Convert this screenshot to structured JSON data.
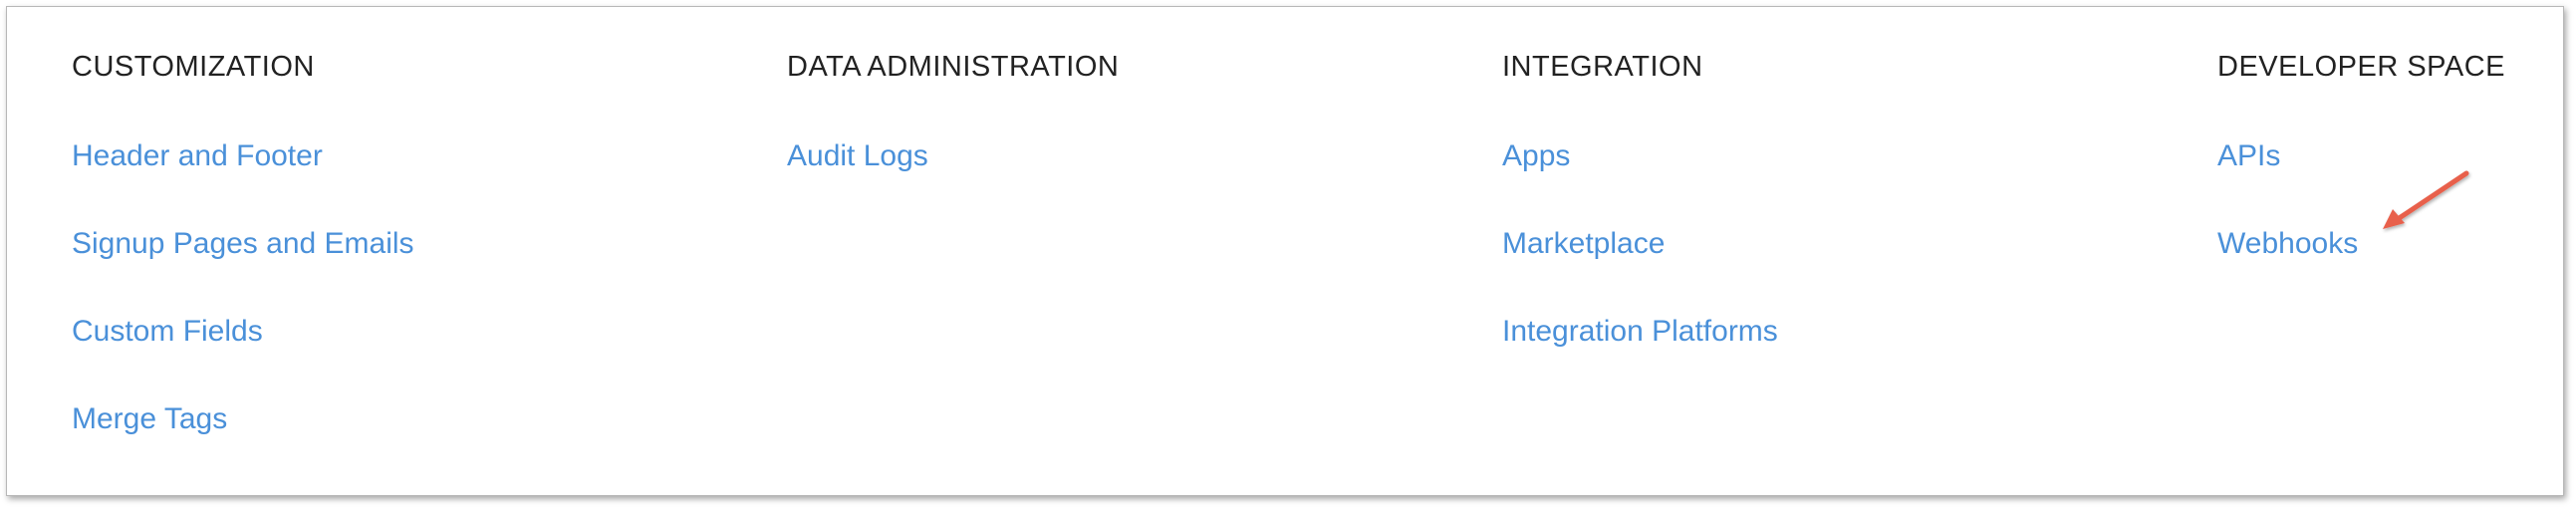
{
  "colors": {
    "link": "#4a90d9",
    "header": "#222222",
    "annotation_arrow": "#e8604c"
  },
  "columns": [
    {
      "title": "CUSTOMIZATION",
      "links": [
        {
          "label": "Header and Footer"
        },
        {
          "label": "Signup Pages and Emails"
        },
        {
          "label": "Custom Fields"
        },
        {
          "label": "Merge Tags"
        }
      ]
    },
    {
      "title": "DATA ADMINISTRATION",
      "links": [
        {
          "label": "Audit Logs"
        }
      ]
    },
    {
      "title": "INTEGRATION",
      "links": [
        {
          "label": "Apps"
        },
        {
          "label": "Marketplace"
        },
        {
          "label": "Integration Platforms"
        }
      ]
    },
    {
      "title": "DEVELOPER SPACE",
      "links": [
        {
          "label": "APIs"
        },
        {
          "label": "Webhooks"
        }
      ]
    }
  ],
  "annotation": {
    "icon": "arrow-pointer-icon",
    "points_to": "Webhooks"
  }
}
